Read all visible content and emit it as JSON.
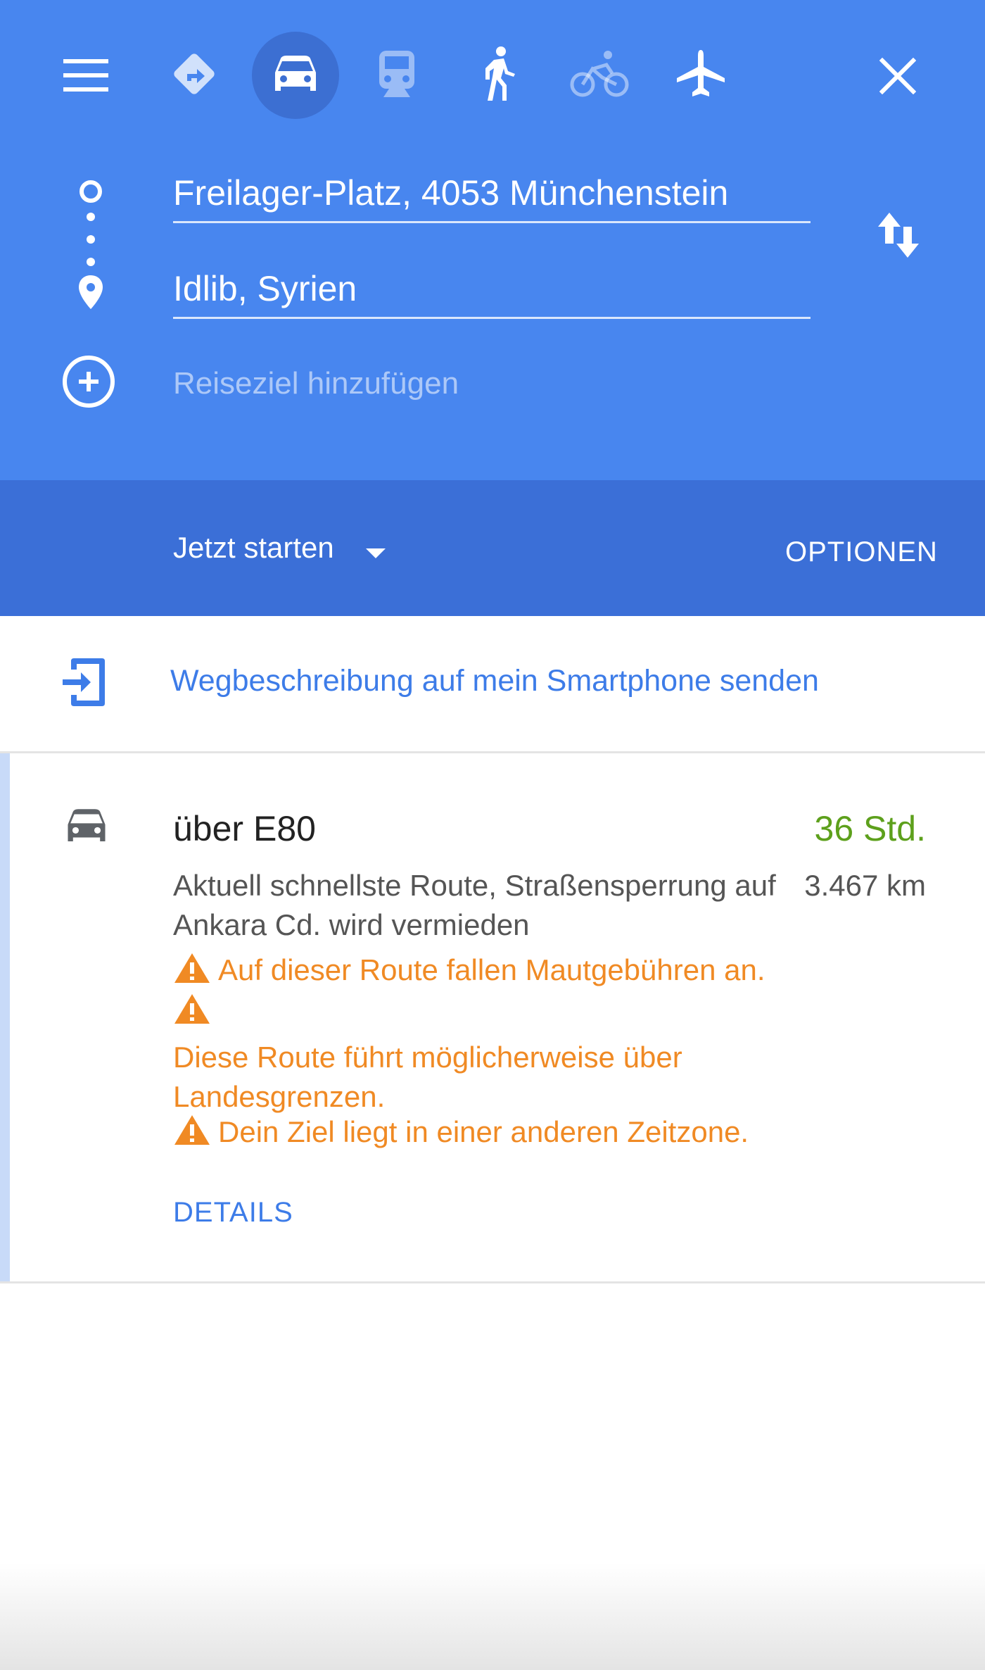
{
  "colors": {
    "header": "#4886ef",
    "options_bar": "#3b6fd7",
    "link": "#3d7ce8",
    "duration": "#5da01c",
    "warning": "#f08a24"
  },
  "header": {
    "menu_icon": "menu-icon",
    "close_icon": "close-icon",
    "swap_icon": "swap-icon",
    "modes": [
      {
        "icon": "directions-icon",
        "active": false
      },
      {
        "icon": "car-icon",
        "active": true
      },
      {
        "icon": "train-icon",
        "active": false
      },
      {
        "icon": "walk-icon",
        "active": false
      },
      {
        "icon": "bike-icon",
        "active": false
      },
      {
        "icon": "plane-icon",
        "active": false
      }
    ],
    "origin": "Freilager-Platz, 4053 Münchenstein",
    "destination": "Idlib, Syrien",
    "add_destination_placeholder": "Reiseziel hinzufügen"
  },
  "options_bar": {
    "depart_label": "Jetzt starten",
    "options_label": "OPTIONEN"
  },
  "send_to_phone": {
    "label": "Wegbeschreibung auf mein Smartphone senden"
  },
  "route": {
    "title": "über E80",
    "duration": "36 Std.",
    "distance": "3.467 km",
    "description": "Aktuell schnellste Route, Straßensperrung auf Ankara Cd. wird vermieden",
    "warnings": [
      "Auf dieser Route fallen Mautgebühren an.",
      "Diese Route führt möglicherweise über Landesgrenzen.",
      "Dein Ziel liegt in einer anderen Zeitzone."
    ],
    "details_label": "DETAILS"
  }
}
